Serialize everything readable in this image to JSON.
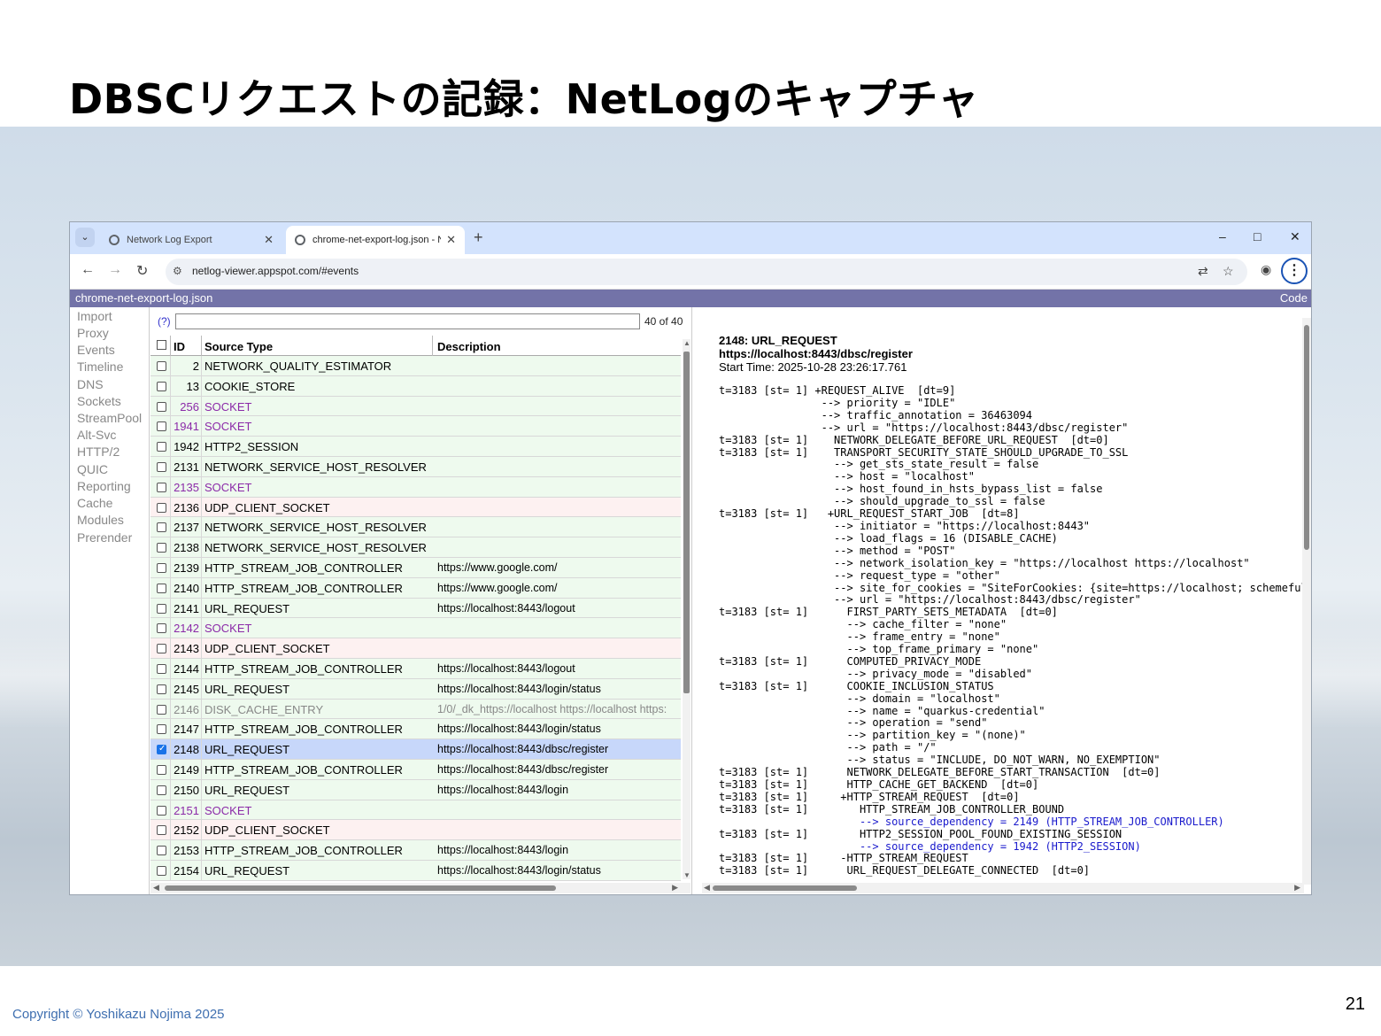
{
  "slide": {
    "title": "DBSCリクエストの記録：NetLogのキャプチャ",
    "copyright": "Copyright © Yoshikazu Nojima 2025",
    "page_number": "21"
  },
  "browser": {
    "tabs": [
      {
        "label": "Network Log Export",
        "icon": "globe-icon"
      },
      {
        "label": "chrome-net-export-log.json - N",
        "icon": "globe-icon",
        "active": true
      }
    ],
    "new_tab": "+",
    "window_controls": {
      "minimize": "–",
      "maximize": "□",
      "close": "✕"
    },
    "url": "netlog-viewer.appspot.com/#events"
  },
  "app": {
    "file_name": "chrome-net-export-log.json",
    "code_label": "Code",
    "nav_items": [
      "Import",
      "Proxy",
      "Events",
      "Timeline",
      "DNS",
      "Sockets",
      "StreamPool",
      "Alt-Svc",
      "HTTP/2",
      "QUIC",
      "Reporting",
      "Cache",
      "Modules",
      "Prerender"
    ],
    "filter": {
      "help": "(?)",
      "value": "",
      "count": "40 of 40"
    },
    "columns": {
      "id": "ID",
      "source_type": "Source Type",
      "description": "Description"
    },
    "rows": [
      {
        "id": "2",
        "type": "NETWORK_QUALITY_ESTIMATOR",
        "desc": "",
        "style": "green"
      },
      {
        "id": "13",
        "type": "COOKIE_STORE",
        "desc": "",
        "style": "green"
      },
      {
        "id": "256",
        "type": "SOCKET",
        "desc": "",
        "style": "purple"
      },
      {
        "id": "1941",
        "type": "SOCKET",
        "desc": "",
        "style": "purple"
      },
      {
        "id": "1942",
        "type": "HTTP2_SESSION",
        "desc": "",
        "style": "green"
      },
      {
        "id": "2131",
        "type": "NETWORK_SERVICE_HOST_RESOLVER",
        "desc": "",
        "style": "green"
      },
      {
        "id": "2135",
        "type": "SOCKET",
        "desc": "",
        "style": "purple"
      },
      {
        "id": "2136",
        "type": "UDP_CLIENT_SOCKET",
        "desc": "",
        "style": "pink"
      },
      {
        "id": "2137",
        "type": "NETWORK_SERVICE_HOST_RESOLVER",
        "desc": "",
        "style": "green"
      },
      {
        "id": "2138",
        "type": "NETWORK_SERVICE_HOST_RESOLVER",
        "desc": "",
        "style": "green"
      },
      {
        "id": "2139",
        "type": "HTTP_STREAM_JOB_CONTROLLER",
        "desc": "https://www.google.com/",
        "style": "green"
      },
      {
        "id": "2140",
        "type": "HTTP_STREAM_JOB_CONTROLLER",
        "desc": "https://www.google.com/",
        "style": "green"
      },
      {
        "id": "2141",
        "type": "URL_REQUEST",
        "desc": "https://localhost:8443/logout",
        "style": "green"
      },
      {
        "id": "2142",
        "type": "SOCKET",
        "desc": "",
        "style": "purple"
      },
      {
        "id": "2143",
        "type": "UDP_CLIENT_SOCKET",
        "desc": "",
        "style": "pink"
      },
      {
        "id": "2144",
        "type": "HTTP_STREAM_JOB_CONTROLLER",
        "desc": "https://localhost:8443/logout",
        "style": "green"
      },
      {
        "id": "2145",
        "type": "URL_REQUEST",
        "desc": "https://localhost:8443/login/status",
        "style": "green"
      },
      {
        "id": "2146",
        "type": "DISK_CACHE_ENTRY",
        "desc": "1/0/_dk_https://localhost https://localhost https:",
        "style": "grey"
      },
      {
        "id": "2147",
        "type": "HTTP_STREAM_JOB_CONTROLLER",
        "desc": "https://localhost:8443/login/status",
        "style": "green"
      },
      {
        "id": "2148",
        "type": "URL_REQUEST",
        "desc": "https://localhost:8443/dbsc/register",
        "style": "selected"
      },
      {
        "id": "2149",
        "type": "HTTP_STREAM_JOB_CONTROLLER",
        "desc": "https://localhost:8443/dbsc/register",
        "style": "green"
      },
      {
        "id": "2150",
        "type": "URL_REQUEST",
        "desc": "https://localhost:8443/login",
        "style": "green"
      },
      {
        "id": "2151",
        "type": "SOCKET",
        "desc": "",
        "style": "purple"
      },
      {
        "id": "2152",
        "type": "UDP_CLIENT_SOCKET",
        "desc": "",
        "style": "pink"
      },
      {
        "id": "2153",
        "type": "HTTP_STREAM_JOB_CONTROLLER",
        "desc": "https://localhost:8443/login",
        "style": "green"
      },
      {
        "id": "2154",
        "type": "URL_REQUEST",
        "desc": "https://localhost:8443/login/status",
        "style": "green"
      }
    ],
    "detail": {
      "heading": "2148: URL_REQUEST",
      "url": "https://localhost:8443/dbsc/register",
      "start_time": "Start Time: 2025-10-28 23:26:17.761",
      "log_lines": [
        {
          "text": "t=3183 [st= 1] +REQUEST_ALIVE  [dt=9]"
        },
        {
          "text": "                --> priority = \"IDLE\""
        },
        {
          "text": "                --> traffic_annotation = 36463094"
        },
        {
          "text": "                --> url = \"https://localhost:8443/dbsc/register\""
        },
        {
          "text": "t=3183 [st= 1]    NETWORK_DELEGATE_BEFORE_URL_REQUEST  [dt=0]"
        },
        {
          "text": "t=3183 [st= 1]    TRANSPORT_SECURITY_STATE_SHOULD_UPGRADE_TO_SSL"
        },
        {
          "text": "                  --> get_sts_state_result = false"
        },
        {
          "text": "                  --> host = \"localhost\""
        },
        {
          "text": "                  --> host_found_in_hsts_bypass_list = false"
        },
        {
          "text": "                  --> should_upgrade_to_ssl = false"
        },
        {
          "text": "t=3183 [st= 1]   +URL_REQUEST_START_JOB  [dt=8]"
        },
        {
          "text": "                  --> initiator = \"https://localhost:8443\""
        },
        {
          "text": "                  --> load_flags = 16 (DISABLE_CACHE)"
        },
        {
          "text": "                  --> method = \"POST\""
        },
        {
          "text": "                  --> network_isolation_key = \"https://localhost https://localhost\""
        },
        {
          "text": "                  --> request_type = \"other\""
        },
        {
          "text": "                  --> site_for_cookies = \"SiteForCookies: {site=https://localhost; schemeful"
        },
        {
          "text": "                  --> url = \"https://localhost:8443/dbsc/register\""
        },
        {
          "text": "t=3183 [st= 1]      FIRST_PARTY_SETS_METADATA  [dt=0]"
        },
        {
          "text": "                    --> cache_filter = \"none\""
        },
        {
          "text": "                    --> frame_entry = \"none\""
        },
        {
          "text": "                    --> top_frame_primary = \"none\""
        },
        {
          "text": "t=3183 [st= 1]      COMPUTED_PRIVACY_MODE"
        },
        {
          "text": "                    --> privacy_mode = \"disabled\""
        },
        {
          "text": "t=3183 [st= 1]      COOKIE_INCLUSION_STATUS"
        },
        {
          "text": "                    --> domain = \"localhost\""
        },
        {
          "text": "                    --> name = \"quarkus-credential\""
        },
        {
          "text": "                    --> operation = \"send\""
        },
        {
          "text": "                    --> partition_key = \"(none)\""
        },
        {
          "text": "                    --> path = \"/\""
        },
        {
          "text": "                    --> status = \"INCLUDE, DO_NOT_WARN, NO_EXEMPTION\""
        },
        {
          "text": "t=3183 [st= 1]      NETWORK_DELEGATE_BEFORE_START_TRANSACTION  [dt=0]"
        },
        {
          "text": "t=3183 [st= 1]      HTTP_CACHE_GET_BACKEND  [dt=0]"
        },
        {
          "text": "t=3183 [st= 1]     +HTTP_STREAM_REQUEST  [dt=0]"
        },
        {
          "text": "t=3183 [st= 1]        HTTP_STREAM_JOB_CONTROLLER_BOUND"
        },
        {
          "text": "                      --> source_dependency = 2149 (HTTP_STREAM_JOB_CONTROLLER)",
          "link": true
        },
        {
          "text": "t=3183 [st= 1]        HTTP2_SESSION_POOL_FOUND_EXISTING_SESSION"
        },
        {
          "text": "                      --> source_dependency = 1942 (HTTP2_SESSION)",
          "link": true
        },
        {
          "text": "t=3183 [st= 1]     -HTTP_STREAM_REQUEST"
        },
        {
          "text": "t=3183 [st= 1]      URL_REQUEST_DELEGATE_CONNECTED  [dt=0]"
        }
      ]
    }
  }
}
